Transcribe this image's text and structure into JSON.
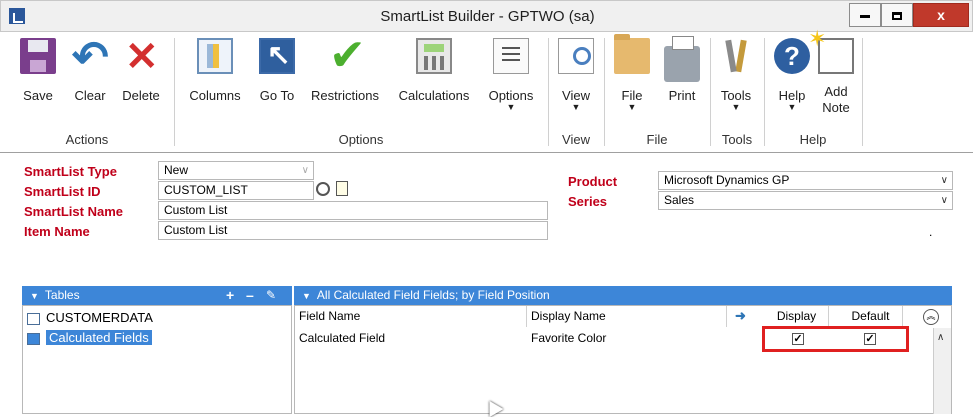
{
  "window": {
    "title": "SmartList Builder  -  GPTWO (sa)",
    "minimize": "minimize",
    "maximize": "maximize",
    "close": "x"
  },
  "ribbon": {
    "buttons": {
      "save": "Save",
      "clear": "Clear",
      "delete": "Delete",
      "columns": "Columns",
      "goto": "Go To",
      "restrictions": "Restrictions",
      "calculations": "Calculations",
      "options": "Options",
      "view": "View",
      "file": "File",
      "print": "Print",
      "tools": "Tools",
      "help": "Help",
      "add_note": "Add Note"
    },
    "groups": {
      "actions": "Actions",
      "options": "Options",
      "view": "View",
      "file": "File",
      "tools": "Tools",
      "help": "Help"
    }
  },
  "form": {
    "labels": {
      "smartlist_type": "SmartList Type",
      "smartlist_id": "SmartList ID",
      "smartlist_name": "SmartList Name",
      "item_name": "Item Name",
      "product": "Product",
      "series": "Series"
    },
    "values": {
      "smartlist_type": "New",
      "smartlist_id": "CUSTOM_LIST",
      "smartlist_name": "Custom List",
      "item_name": "Custom List",
      "product": "Microsoft Dynamics GP",
      "series": "Sales"
    },
    "dot": "."
  },
  "tables_panel": {
    "header": "Tables",
    "items": [
      {
        "label": "CUSTOMERDATA",
        "selected": false
      },
      {
        "label": "Calculated Fields",
        "selected": true
      }
    ]
  },
  "fields_panel": {
    "header": "All Calculated Field Fields; by Field Position",
    "columns": {
      "field_name": "Field Name",
      "display_name": "Display Name",
      "display": "Display",
      "default": "Default"
    },
    "rows": [
      {
        "field_name": "Calculated Field",
        "display_name": "Favorite Color",
        "display": true,
        "default": true
      }
    ]
  },
  "colors": {
    "accent_blue": "#3d86d8",
    "label_red": "#c0001a",
    "highlight_red": "#e02020"
  }
}
